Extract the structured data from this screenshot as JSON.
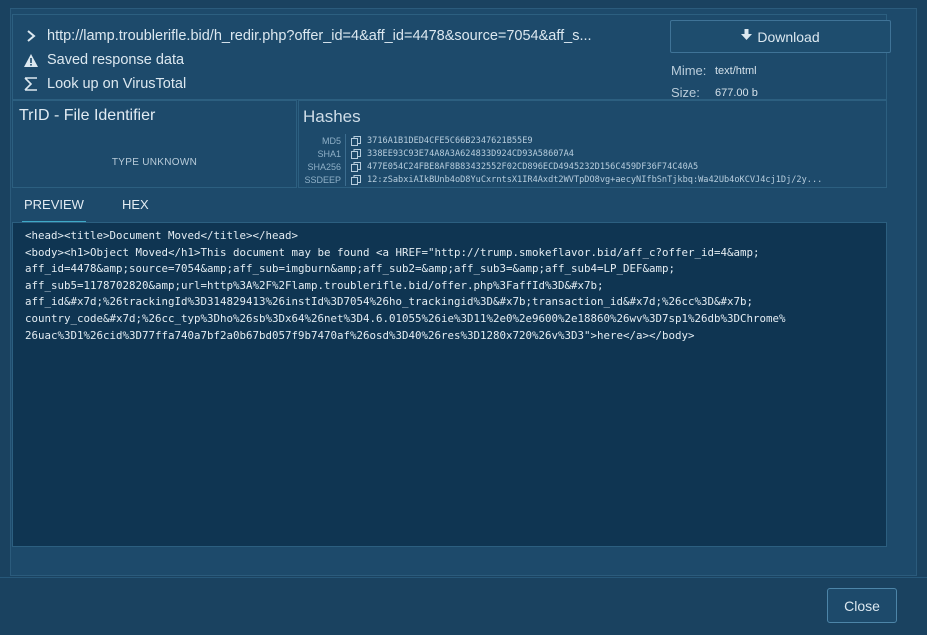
{
  "header": {
    "url": "http://lamp.troublerifle.bid/h_redir.php?offer_id=4&aff_id=4478&source=7054&aff_s...",
    "saved_label": "Saved response data",
    "virustotal_label": "Look up on VirusTotal",
    "download_label": "Download",
    "mime_key": "Mime:",
    "mime_value": "text/html",
    "size_key": "Size:",
    "size_value": "677.00 b"
  },
  "trid": {
    "title": "TrID - File Identifier",
    "type": "TYPE UNKNOWN"
  },
  "hashes": {
    "title": "Hashes",
    "rows": [
      {
        "label": "MD5",
        "value": "3716A1B1DED4CFE5C66B2347621B55E9"
      },
      {
        "label": "SHA1",
        "value": "338EE93C93E74A8A3A624833D924CD93A58607A4"
      },
      {
        "label": "SHA256",
        "value": "477E054C24FBE8AF8B83432552F02CD896ECD4945232D156C459DF36F74C40A5"
      },
      {
        "label": "SSDEEP",
        "value": "12:zSabxiAIkBUnb4oD8YuCxrntsX1IR4Axdt2WVTpDO8vg+aecyNIfbSnTjkbq:Wa42Ub4oKCVJ4cj1Dj/2y..."
      }
    ]
  },
  "tabs": [
    {
      "label": "PREVIEW",
      "active": true
    },
    {
      "label": "HEX",
      "active": false
    }
  ],
  "preview": {
    "content": "<head><title>Document Moved</title></head>\n<body><h1>Object Moved</h1>This document may be found <a HREF=\"http://trump.smokeflavor.bid/aff_c?offer_id=4&amp;\naff_id=4478&amp;source=7054&amp;aff_sub=imgburn&amp;aff_sub2=&amp;aff_sub3=&amp;aff_sub4=LP_DEF&amp;\naff_sub5=1178702820&amp;url=http%3A%2F%2Flamp.troublerifle.bid/offer.php%3FaffId%3D&#x7b;\naff_id&#x7d;%26trackingId%3D314829413%26instId%3D7054%26ho_trackingid%3D&#x7b;transaction_id&#x7d;%26cc%3D&#x7b;\ncountry_code&#x7d;%26cc_typ%3Dho%26sb%3Dx64%26net%3D4.6.01055%26ie%3D11%2e0%2e9600%2e18860%26wv%3D7sp1%26db%3DChrome%\n26uac%3D1%26cid%3D77ffa740a7bf2a0b67bd057f9b7470af%26osd%3D40%26res%3D1280x720%26v%3D3\">here</a></body>"
  },
  "footer": {
    "close_label": "Close"
  },
  "colors": {
    "background": "#1a4260",
    "panel": "#1d4a6b",
    "preview_bg": "#0f3552",
    "accent": "#3fa9c7"
  }
}
